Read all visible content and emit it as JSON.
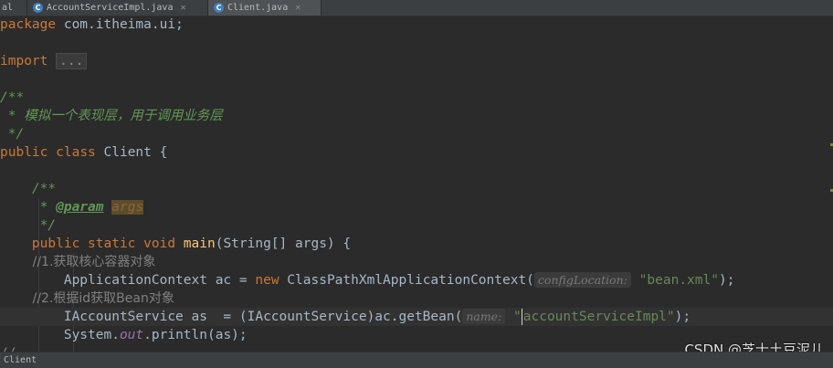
{
  "tabs": [
    {
      "label": "al",
      "icon": "class-icon",
      "active": false
    },
    {
      "label": "AccountServiceImpl.java",
      "icon": "class-icon",
      "active": false
    },
    {
      "label": "Client.java",
      "icon": "class-icon",
      "active": true
    }
  ],
  "code": {
    "l1_package": "package",
    "l1_name": " com.itheima.ui;",
    "l3_import": "import",
    "l3_fold": "...",
    "l5_open": "/**",
    "l6_text": " * 模拟一个表现层，用于调用业务层",
    "l7_close": " */",
    "l8_public": "public",
    "l8_class": "class",
    "l8_name": " Client {",
    "l10_open": "    /**",
    "l11_star": "     * ",
    "l11_tag": "@param",
    "l11_arg": "args",
    "l12_close": "     */",
    "l13_mods": "    public static void ",
    "l13_method": "main",
    "l13_rest": "(String[] args) {",
    "l14_comment": "        //1.获取核心容器对象",
    "l15_a": "        ApplicationContext ac = ",
    "l15_new": "new",
    "l15_b": " ClassPathXmlApplicationContext(",
    "l15_hint": "configLocation:",
    "l15_str": "\"bean.xml\"",
    "l15_end": ");",
    "l16_comment": "        //2.根据id获取Bean对象",
    "l17_a": "        IAccountService as  = (IAccountService)ac.getBean(",
    "l17_hint": "name:",
    "l17_str1": "\"",
    "l17_str2": "accountServiceImpl\"",
    "l17_end": ");",
    "l18_a": "        System.",
    "l18_out": "out",
    "l18_b": ".println(as);",
    "l19_partial": "//"
  },
  "status": {
    "label": "Client"
  },
  "watermark": "CSDN @芝士土豆泥儿"
}
